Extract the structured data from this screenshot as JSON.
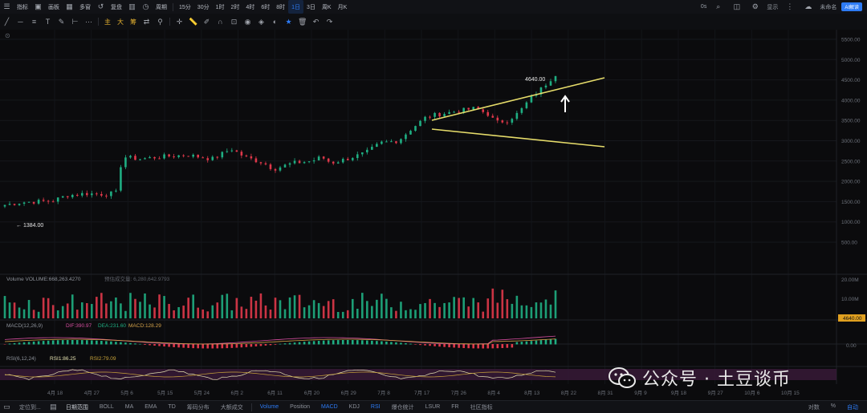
{
  "topbar": {
    "items": [
      "指标",
      "画板",
      "多窗",
      "复盘",
      "周期",
      "15分",
      "30分",
      "1时",
      "2时",
      "4时",
      "6时",
      "8时",
      "1日",
      "3日",
      "周K",
      "月K"
    ],
    "active_item": "1日",
    "right": {
      "label_0s": "0s",
      "display_label": "显示",
      "user_label": "未命名",
      "ai_badge": "AI解读"
    }
  },
  "toolbar": {
    "indicator_labels": [
      "主",
      "大",
      "筹"
    ]
  },
  "price_axis": {
    "ticks": [
      "5500.00",
      "5000.00",
      "4500.00",
      "4000.00",
      "3500.00",
      "3000.00",
      "2500.00",
      "2000.00",
      "1500.00",
      "1000.00",
      "500.00"
    ],
    "current_price": "4640.00",
    "low_price": "1384.00"
  },
  "volume_panel": {
    "label": "Volume  VOLUME:668,263.4270",
    "secondary": "预估成交量: 6,280,642.9793",
    "ticks": [
      "20.00M",
      "10.00M"
    ],
    "price_tag": "4640.00"
  },
  "macd_panel": {
    "label": "MACD(12,26,9)",
    "dif": "DIF:390.97",
    "dea": "DEA:231.60",
    "macd": "MACD:128.29",
    "tick": "0.00"
  },
  "rsi_panel": {
    "label": "RSI(6,12,24)",
    "rsi1": "RSI1:86.25",
    "rsi2": "RSI2:79.09"
  },
  "date_axis": [
    "4月 18",
    "4月 27",
    "5月 6",
    "5月 15",
    "5月 24",
    "6月 2",
    "6月 11",
    "6月 20",
    "6月 29",
    "7月 8",
    "7月 17",
    "7月 26",
    "8月 4",
    "8月 13",
    "8月 22",
    "8月 31",
    "9月 9",
    "9月 18",
    "9月 27",
    "10月 6",
    "10月 15"
  ],
  "bottombar": {
    "left": [
      "定位到...",
      "日期范围",
      "BOLL",
      "MA",
      "EMA",
      "TD",
      "筹码分布",
      "大额成交"
    ],
    "indicators": [
      "Volume",
      "Position",
      "MACD",
      "KDJ",
      "RSI",
      "爆仓统计",
      "LSUR",
      "FR",
      "社区指标"
    ],
    "active": "MACD",
    "right": [
      "对数",
      "%",
      "自动"
    ]
  },
  "watermark": {
    "text": "公众号 · 土豆谈币"
  },
  "colors": {
    "up": "#1fae82",
    "down": "#e0384a",
    "trendline": "#e6dc6a",
    "accent": "#2d7bf4",
    "macd_dif": "#d84fa0",
    "macd_dea": "#d4a24a"
  },
  "chart_data": {
    "type": "candlestick",
    "ylim": [
      0,
      5800
    ],
    "markers": {
      "high_label": "4640.00",
      "low_label": "1384.00"
    }
  }
}
